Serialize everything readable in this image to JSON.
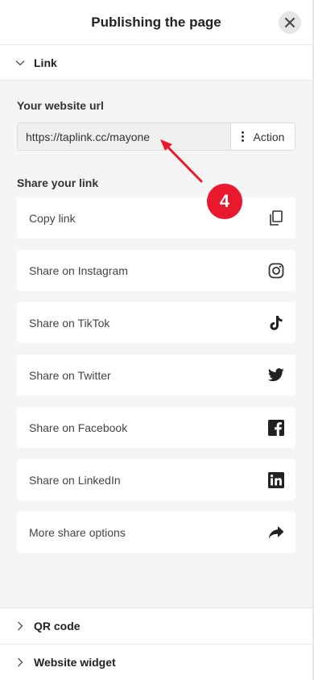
{
  "header": {
    "title": "Publishing the page"
  },
  "link_section": {
    "label": "Link"
  },
  "website_url": {
    "label": "Your website url",
    "value": "https://taplink.cc/mayone",
    "action_label": "Action"
  },
  "share": {
    "label": "Share your link",
    "items": [
      {
        "label": "Copy link",
        "icon": "copy-icon"
      },
      {
        "label": "Share on Instagram",
        "icon": "instagram-icon"
      },
      {
        "label": "Share on TikTok",
        "icon": "tiktok-icon"
      },
      {
        "label": "Share on Twitter",
        "icon": "twitter-icon"
      },
      {
        "label": "Share on Facebook",
        "icon": "facebook-icon"
      },
      {
        "label": "Share on LinkedIn",
        "icon": "linkedin-icon"
      },
      {
        "label": "More share options",
        "icon": "share-arrow-icon"
      }
    ]
  },
  "qr_section": {
    "label": "QR code"
  },
  "widget_section": {
    "label": "Website widget"
  },
  "annotation": {
    "step": "4",
    "color": "#e8192c"
  }
}
